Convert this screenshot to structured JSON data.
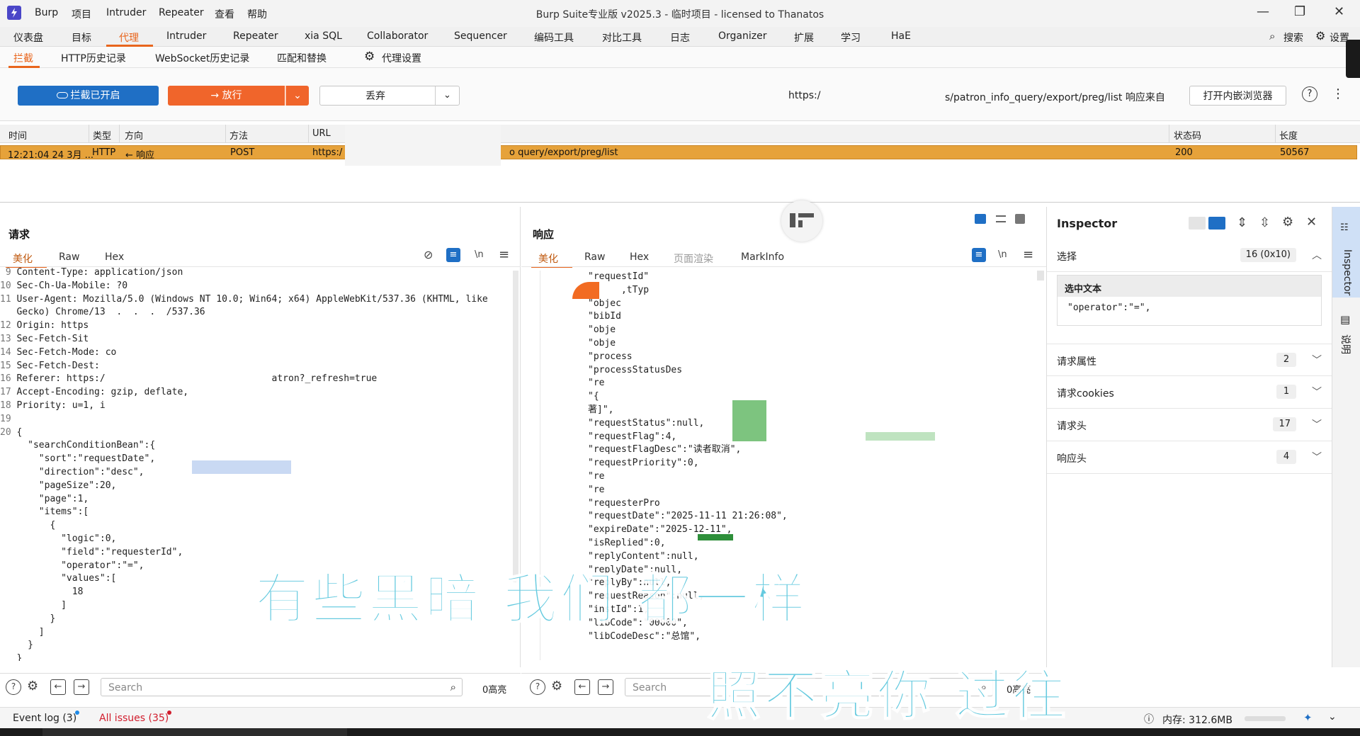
{
  "app": {
    "title": "Burp Suite专业版  v2025.3 - 临时项目 - licensed to Thanatos",
    "menu": [
      "Burp",
      "项目",
      "Intruder",
      "Repeater",
      "查看",
      "帮助"
    ]
  },
  "main_tabs": [
    "仪表盘",
    "目标",
    "代理",
    "Intruder",
    "Repeater",
    "xia SQL",
    "Collaborator",
    "Sequencer",
    "编码工具",
    "对比工具",
    "日志",
    "Organizer",
    "扩展",
    "学习",
    "HaE"
  ],
  "main_tabs_active": "代理",
  "top_right": {
    "search_label": "搜索",
    "settings_label": "设置"
  },
  "sub_tabs": [
    "拦截",
    "HTTP历史记录",
    "WebSocket历史记录",
    "匹配和替换",
    "代理设置"
  ],
  "toolbar": {
    "intercept_label": "拦截已开启",
    "forward_label": "放行",
    "drop_label": "丢弃",
    "url_prefix": "https:/",
    "url_suffix": "s/patron_info_query/export/preg/list 响应来自",
    "open_browser_label": "打开内嵌浏览器"
  },
  "table": {
    "headers": [
      "时间",
      "类型",
      "方向",
      "方法",
      "URL",
      "状态码",
      "长度"
    ],
    "row": {
      "time": "12:21:04 24 3月 ...",
      "type": "HTTP",
      "direction": "← 响应",
      "method": "POST",
      "url_start": "https:/",
      "url_end": "o query/export/preg/list",
      "status": "200",
      "length": "50567"
    }
  },
  "request": {
    "title": "请求",
    "tabs": [
      "美化",
      "Raw",
      "Hex"
    ],
    "lines": [
      {
        "n": "9",
        "t": "Content-Type: application/json"
      },
      {
        "n": "10",
        "t": "Sec-Ch-Ua-Mobile: ?0"
      },
      {
        "n": "11",
        "t": "User-Agent: Mozilla/5.0 (Windows NT 10.0; Win64; x64) AppleWebKit/537.36 (KHTML, like"
      },
      {
        "n": "",
        "t": "Gecko) Chrome/13  .  .  .  /537.36"
      },
      {
        "n": "12",
        "t": "Origin: https"
      },
      {
        "n": "13",
        "t": "Sec-Fetch-Sit"
      },
      {
        "n": "14",
        "t": "Sec-Fetch-Mode: co"
      },
      {
        "n": "15",
        "t": "Sec-Fetch-Dest:"
      },
      {
        "n": "16",
        "t": "Referer: https:/                              atron?_refresh=true"
      },
      {
        "n": "17",
        "t": "Accept-Encoding: gzip, deflate,"
      },
      {
        "n": "18",
        "t": "Priority: u=1, i"
      },
      {
        "n": "19",
        "t": ""
      },
      {
        "n": "20",
        "t": "{"
      },
      {
        "n": "",
        "t": "  \"searchConditionBean\":{"
      },
      {
        "n": "",
        "t": "    \"sort\":\"requestDate\","
      },
      {
        "n": "",
        "t": "    \"direction\":\"desc\","
      },
      {
        "n": "",
        "t": "    \"pageSize\":20,"
      },
      {
        "n": "",
        "t": "    \"page\":1,"
      },
      {
        "n": "",
        "t": "    \"items\":["
      },
      {
        "n": "",
        "t": "      {"
      },
      {
        "n": "",
        "t": "        \"logic\":0,"
      },
      {
        "n": "",
        "t": "        \"field\":\"requesterId\","
      },
      {
        "n": "",
        "t": "        \"operator\":\"=\","
      },
      {
        "n": "",
        "t": "        \"values\":["
      },
      {
        "n": "",
        "t": "          18"
      },
      {
        "n": "",
        "t": "        ]"
      },
      {
        "n": "",
        "t": "      }"
      },
      {
        "n": "",
        "t": "    ]"
      },
      {
        "n": "",
        "t": "  }"
      },
      {
        "n": "",
        "t": "}"
      }
    ],
    "search_placeholder": "Search",
    "highlight_count": "0高亮"
  },
  "response": {
    "title": "响应",
    "tabs": [
      "美化",
      "Raw",
      "Hex",
      "页面渲染",
      "MarkInfo"
    ],
    "lines": [
      "\"requestId\"",
      "      ,tTyp",
      "",
      "",
      "\"objec",
      "\"bibId",
      "\"obje",
      "\"obje",
      "\"process",
      "\"processStatusDes",
      "\"re",
      "\"{",
      "著]\",",
      "\"requestStatus\":null,",
      "\"requestFlag\":4,",
      "\"requestFlagDesc\":\"读者取消\",",
      "\"requestPriority\":0,",
      "\"re",
      "\"re",
      "\"requesterPro",
      "\"requestDate\":\"2025-11-11 21:26:08\",",
      "\"expireDate\":\"2025-12-11\",",
      "\"isReplied\":0,",
      "\"replyContent\":null,",
      "\"replyDate\":null,",
      "\"replyBy\":null,",
      "\"requestReason\":null,",
      "\"instId\":1,",
      "\"libCode\":\"00000\",",
      "\"libCodeDesc\":\"总馆\","
    ],
    "search_placeholder": "Search",
    "highlight_count": "0高亮"
  },
  "inspector": {
    "title": "Inspector",
    "selection_label": "选择",
    "selection_count": "16 (0x10)",
    "selected_text_label": "选中文本",
    "selected_text": "\"operator\":\"=\",",
    "sections": [
      {
        "label": "请求属性",
        "count": "2"
      },
      {
        "label": "请求cookies",
        "count": "1"
      },
      {
        "label": "请求头",
        "count": "17"
      },
      {
        "label": "响应头",
        "count": "4"
      }
    ]
  },
  "side_tabs": [
    "Inspector",
    "说明"
  ],
  "status": {
    "event_log": "Event log (3)",
    "all_issues": "All issues (35)",
    "memory": "内存: 312.6MB"
  },
  "overlay": {
    "line1": "有些黑暗  我们  都一样",
    "line2": "照不亮你  过往"
  },
  "colors": {
    "accent": "#e8651d",
    "intercept_blue": "#1f6fc5",
    "row_highlight": "#e6a23a",
    "lyric": "#58c6dd"
  }
}
